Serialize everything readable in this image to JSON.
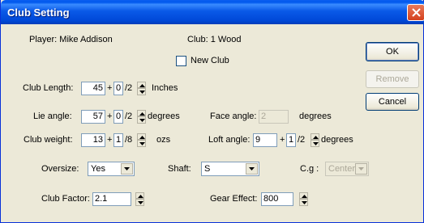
{
  "window": {
    "title": "Club Setting"
  },
  "info": {
    "player": "Player:  Mike Addison",
    "club": "Club:  1 Wood",
    "new_club_label": "New Club"
  },
  "buttons": {
    "ok": "OK",
    "remove": "Remove",
    "cancel": "Cancel"
  },
  "club_length": {
    "label": "Club Length:",
    "whole": "45",
    "plus": "+",
    "frac": "0",
    "den": "/2",
    "unit": "Inches"
  },
  "lie_angle": {
    "label": "Lie angle:",
    "whole": "57",
    "plus": "+",
    "frac": "0",
    "den": "/2",
    "unit": "degrees"
  },
  "face_angle": {
    "label": "Face angle:",
    "value": "2",
    "unit": "degrees"
  },
  "club_weight": {
    "label": "Club weight:",
    "whole": "13",
    "plus": "+",
    "frac": "1",
    "den": "/8",
    "unit": "ozs"
  },
  "loft_angle": {
    "label": "Loft angle:",
    "whole": "9",
    "plus": "+",
    "frac": "1",
    "den": "/2",
    "unit": "degrees"
  },
  "oversize": {
    "label": "Oversize:",
    "value": "Yes"
  },
  "shaft": {
    "label": "Shaft:",
    "value": "S"
  },
  "cg": {
    "label": "C.g :",
    "value": "Center"
  },
  "club_factor": {
    "label": "Club Factor:",
    "value": "2.1"
  },
  "gear_effect": {
    "label": "Gear Effect:",
    "value": "800"
  }
}
